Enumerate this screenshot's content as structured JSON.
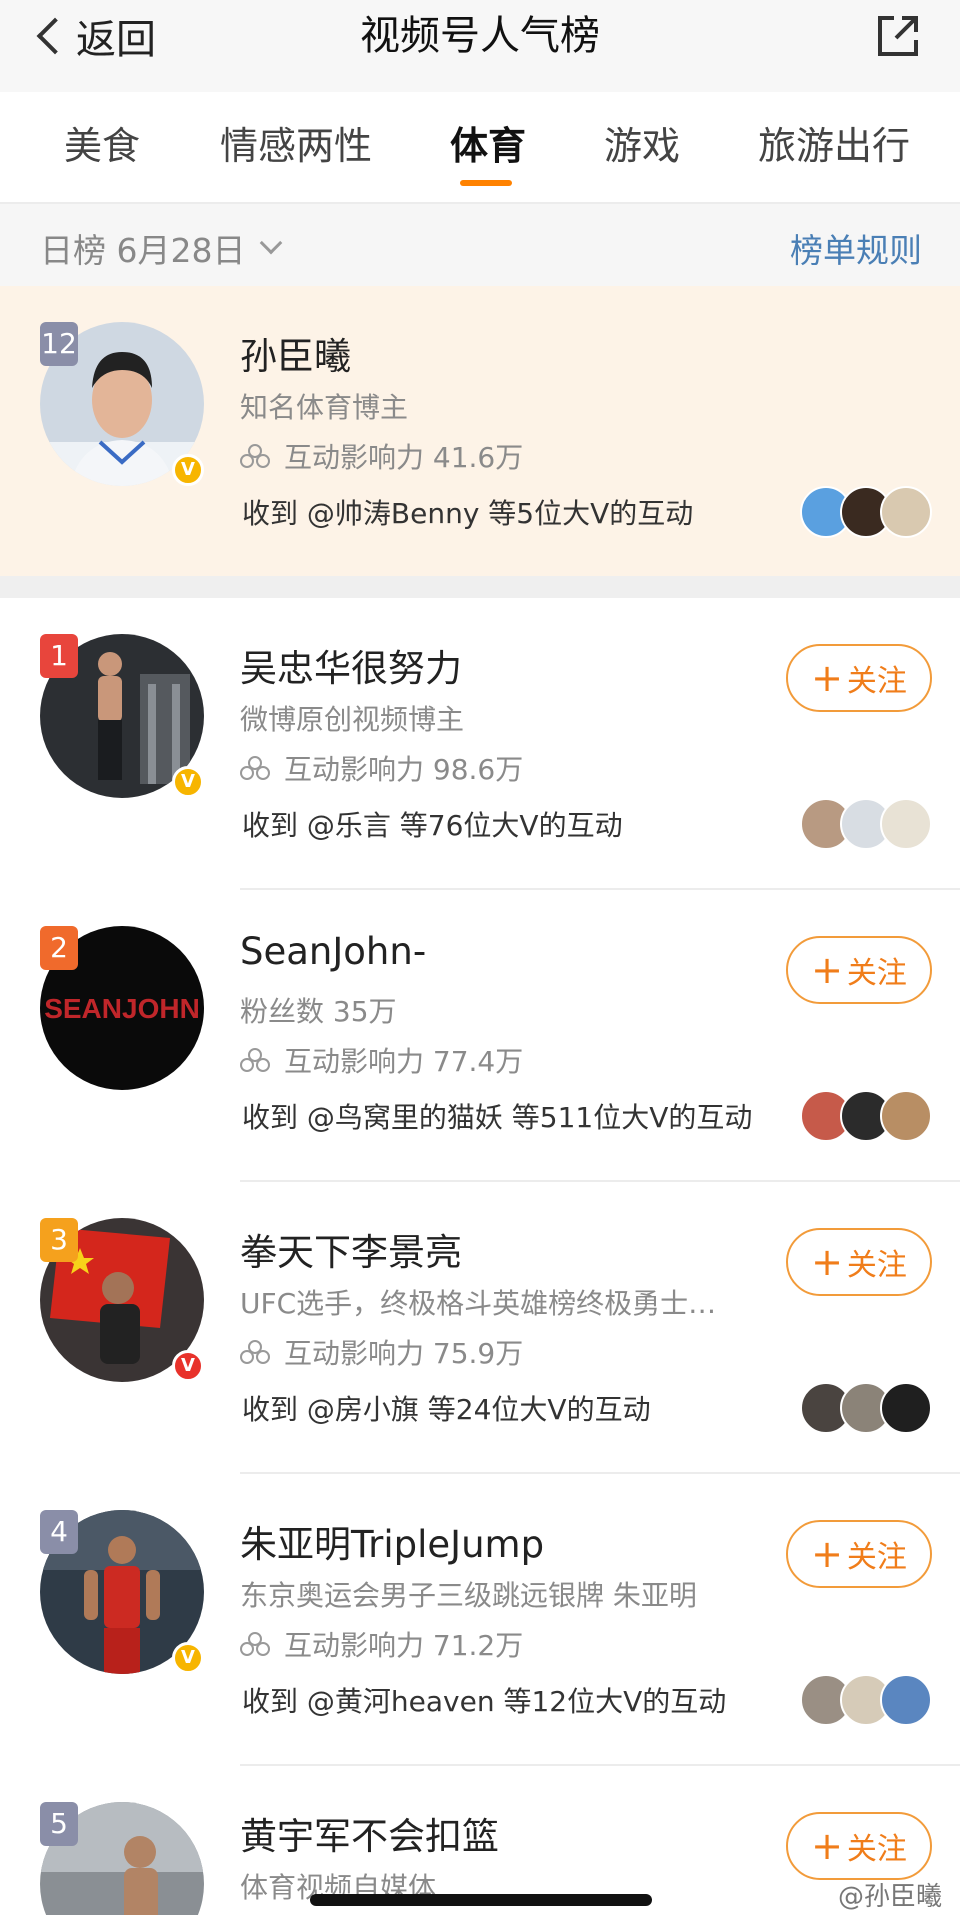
{
  "header": {
    "back_label": "返回",
    "title": "视频号人气榜",
    "share_icon": "share-external-icon"
  },
  "tabs": [
    {
      "label": "美食",
      "active": false
    },
    {
      "label": "情感两性",
      "active": false
    },
    {
      "label": "体育",
      "active": true
    },
    {
      "label": "游戏",
      "active": false
    },
    {
      "label": "旅游出行",
      "active": false
    }
  ],
  "subbar": {
    "date_label": "日榜 6月28日",
    "rules_label": "榜单规则"
  },
  "colors": {
    "accent": "#ff8200",
    "link": "#4a7fb5",
    "highlight_bg": "#fdf3e7"
  },
  "highlight": {
    "rank": "12",
    "name": "孙臣曦",
    "desc": "知名体育博主",
    "influence": "互动影响力 41.6万",
    "received": "收到 @帅涛Benny 等5位大V的互动"
  },
  "entries": [
    {
      "rank": "1",
      "name": "吴忠华很努力",
      "desc": "微博原创视频博主",
      "influence": "互动影响力 98.6万",
      "received": "收到 @乐言 等76位大V的互动",
      "follow_label": "关注"
    },
    {
      "rank": "2",
      "name": "SeanJohn-",
      "desc": "粉丝数 35万",
      "influence": "互动影响力 77.4万",
      "received": "收到 @鸟窝里的猫妖 等511位大V的互动",
      "follow_label": "关注",
      "avatar_text": "SEANJOHN"
    },
    {
      "rank": "3",
      "name": "拳天下李景亮",
      "desc": "UFC选手，终极格斗英雄榜终极勇士…",
      "influence": "互动影响力 75.9万",
      "received": "收到 @房小旗 等24位大V的互动",
      "follow_label": "关注"
    },
    {
      "rank": "4",
      "name": "朱亚明TripleJump",
      "desc": "东京奥运会男子三级跳远银牌 朱亚明",
      "influence": "互动影响力 71.2万",
      "received": "收到 @黄河heaven 等12位大V的互动",
      "follow_label": "关注"
    },
    {
      "rank": "5",
      "name": "黄宇军不会扣篮",
      "desc": "体育视频自媒体",
      "follow_label": "关注"
    }
  ],
  "watermark": "@孙臣曦"
}
